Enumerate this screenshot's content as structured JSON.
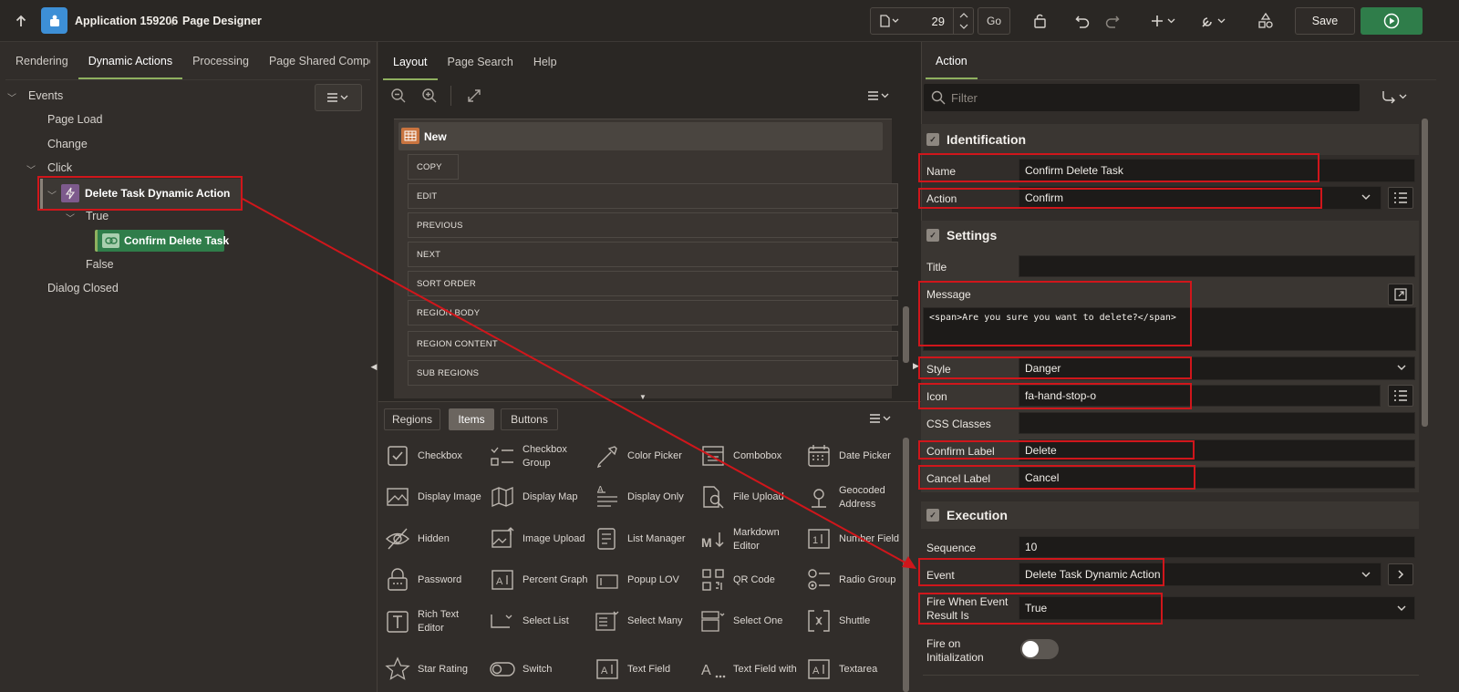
{
  "header": {
    "app_name": "Application 159206",
    "separator": "\\",
    "page_designer": "Page Designer",
    "page_number": "29",
    "go_label": "Go",
    "save_label": "Save"
  },
  "left_panel": {
    "tabs": [
      "Rendering",
      "Dynamic Actions",
      "Processing",
      "Page Shared Components"
    ],
    "tree": {
      "events": "Events",
      "page_load": "Page Load",
      "change": "Change",
      "click": "Click",
      "dynamic_action": "Delete Task Dynamic Action",
      "true_label": "True",
      "true_action": "Confirm Delete Task",
      "false_label": "False",
      "dialog_closed": "Dialog Closed"
    }
  },
  "middle_panel": {
    "tabs": [
      "Layout",
      "Page Search",
      "Help"
    ],
    "region_title": "New",
    "region_slots": [
      "COPY",
      "EDIT",
      "PREVIOUS",
      "NEXT",
      "SORT ORDER",
      "REGION BODY",
      "REGION CONTENT",
      "SUB REGIONS"
    ],
    "gallery_tabs": [
      "Regions",
      "Items",
      "Buttons"
    ],
    "gallery_items": [
      [
        "Checkbox",
        "Checkbox Group",
        "Color Picker",
        "Combobox",
        "Date Picker"
      ],
      [
        "Display Image",
        "Display Map",
        "Display Only",
        "File Upload",
        "Geocoded Address"
      ],
      [
        "Hidden",
        "Image Upload",
        "List Manager",
        "Markdown Editor",
        "Number Field"
      ],
      [
        "Password",
        "Percent Graph",
        "Popup LOV",
        "QR Code",
        "Radio Group"
      ],
      [
        "Rich Text Editor",
        "Select List",
        "Select Many",
        "Select One",
        "Shuttle"
      ],
      [
        "Star Rating",
        "Switch",
        "Text Field",
        "Text Field with",
        "Textarea"
      ]
    ]
  },
  "right_panel": {
    "tab": "Action",
    "filter_placeholder": "Filter",
    "sections": {
      "identification": "Identification",
      "settings": "Settings",
      "execution": "Execution"
    },
    "fields": {
      "name_label": "Name",
      "name_value": "Confirm Delete Task",
      "action_label": "Action",
      "action_value": "Confirm",
      "title_label": "Title",
      "title_value": "",
      "message_label": "Message",
      "message_value": "<span>Are you sure you want to delete?</span>",
      "style_label": "Style",
      "style_value": "Danger",
      "icon_label": "Icon",
      "icon_value": "fa-hand-stop-o",
      "css_label": "CSS Classes",
      "css_value": "",
      "confirm_label": "Confirm Label",
      "confirm_value": "Delete",
      "cancel_label": "Cancel Label",
      "cancel_value": "Cancel",
      "sequence_label": "Sequence",
      "sequence_value": "10",
      "event_label": "Event",
      "event_value": "Delete Task Dynamic Action",
      "fire_when_label": "Fire When Event Result Is",
      "fire_when_value": "True",
      "fire_init_label": "Fire on Initialization"
    },
    "fire_on_init": false
  },
  "colors": {
    "accent_green": "#2f7d4a",
    "highlight_red": "#d0161b",
    "app_blue": "#3d8fd6",
    "tab_underline": "#8fb05f"
  }
}
